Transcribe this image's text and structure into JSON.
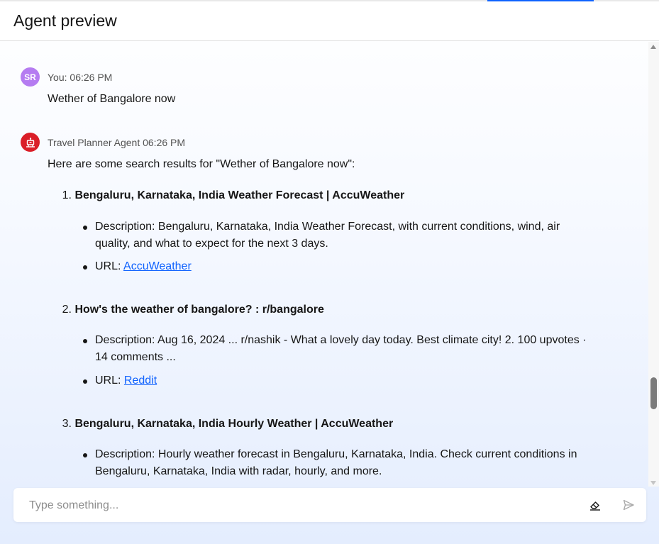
{
  "header": {
    "title": "Agent preview"
  },
  "messages": [
    {
      "sender_meta": "You: 06:26 PM",
      "avatar_initials": "SR",
      "text": "Wether of Bangalore now"
    },
    {
      "sender_meta": "Travel Planner Agent 06:26 PM",
      "intro": "Here are some search results for \"Wether of Bangalore now\":"
    }
  ],
  "results": [
    {
      "num": "1.",
      "title": "Bengaluru, Karnataka, India Weather Forecast | AccuWeather",
      "description": "Description: Bengaluru, Karnataka, India Weather Forecast, with current conditions, wind, air quality, and what to expect for the next 3 days.",
      "url_prefix": "URL: ",
      "url_label": "AccuWeather"
    },
    {
      "num": "2.",
      "title": "How's the weather of bangalore? : r/bangalore",
      "description": "Description: Aug 16, 2024 ... r/nashik - What a lovely day today. Best climate city! 2. 100 upvotes · 14 comments ...",
      "url_prefix": "URL: ",
      "url_label": "Reddit"
    },
    {
      "num": "3.",
      "title": "Bengaluru, Karnataka, India Hourly Weather | AccuWeather",
      "description": "Description: Hourly weather forecast in Bengaluru, Karnataka, India. Check current conditions in Bengaluru, Karnataka, India with radar, hourly, and more."
    }
  ],
  "input": {
    "placeholder": "Type something...",
    "value": ""
  },
  "icons": {
    "clear": "eraser-icon",
    "send": "send-icon",
    "agent_avatar": "robot-icon"
  },
  "colors": {
    "accent": "#0f62fe",
    "user_avatar": "#b57cf1",
    "agent_avatar": "#da1e28"
  }
}
